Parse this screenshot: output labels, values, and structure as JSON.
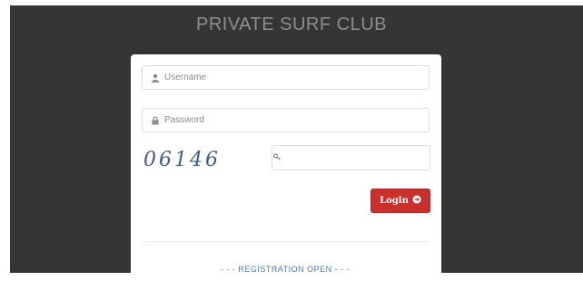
{
  "page": {
    "title": "PRIVATE SURF CLUB"
  },
  "login_form": {
    "username_placeholder": "Username",
    "password_placeholder": "Password",
    "captcha_text": "06146",
    "captcha_value": "",
    "login_label": "Login",
    "registration_link": "- - - REGISTRATION OPEN - - -"
  },
  "icons": {
    "username": "user-icon",
    "password": "lock-icon",
    "captcha": "key-icon",
    "login": "arrow-right-circle-icon"
  },
  "colors": {
    "background": "#353535",
    "card": "#ffffff",
    "title": "#8e8e8e",
    "login_button": "#c9302c",
    "captcha": "#3c5b8c",
    "link": "#4a7ab8"
  }
}
